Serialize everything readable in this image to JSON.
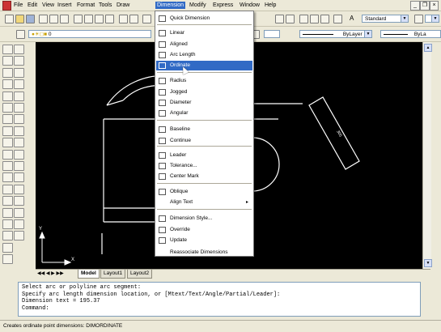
{
  "menubar": {
    "items": [
      "File",
      "Edit",
      "View",
      "Insert",
      "Format",
      "Tools",
      "Draw",
      "Dimension",
      "Modify",
      "Express",
      "Window",
      "Help"
    ],
    "active": "Dimension"
  },
  "toolbar": {
    "text_style": "Standard",
    "layer_value": "0",
    "linetype_value": "ByLayer",
    "lineweight_value": "ByLa"
  },
  "dimension_menu": {
    "items": [
      {
        "label": "Quick Dimension",
        "icon": "quick-dimension-icon"
      },
      {
        "label": "Linear",
        "icon": "linear-dim-icon"
      },
      {
        "label": "Aligned",
        "icon": "aligned-dim-icon"
      },
      {
        "label": "Arc Length",
        "icon": "arc-length-icon"
      },
      {
        "label": "Ordinate",
        "icon": "ordinate-icon",
        "highlighted": true
      },
      {
        "label": "Radius",
        "icon": "radius-icon"
      },
      {
        "label": "Jogged",
        "icon": "jogged-icon"
      },
      {
        "label": "Diameter",
        "icon": "diameter-icon"
      },
      {
        "label": "Angular",
        "icon": "angular-icon"
      },
      {
        "label": "Baseline",
        "icon": "baseline-icon"
      },
      {
        "label": "Continue",
        "icon": "continue-icon"
      },
      {
        "label": "Leader",
        "icon": "leader-icon"
      },
      {
        "label": "Tolerance...",
        "icon": "tolerance-icon"
      },
      {
        "label": "Center Mark",
        "icon": "center-mark-icon"
      },
      {
        "label": "Oblique",
        "icon": "oblique-icon"
      },
      {
        "label": "Align Text",
        "icon": "",
        "submenu": true
      },
      {
        "label": "Dimension Style...",
        "icon": "dimension-style-icon"
      },
      {
        "label": "Override",
        "icon": "override-icon"
      },
      {
        "label": "Update",
        "icon": "update-icon"
      },
      {
        "label": "Reassociate Dimensions",
        "icon": ""
      }
    ]
  },
  "drawing": {
    "dimension_text": "305"
  },
  "layout_tabs": [
    "Model",
    "Layout1",
    "Layout2"
  ],
  "active_tab": "Model",
  "command_window": {
    "lines": [
      "Select arc or polyline arc segment:",
      "Specify arc length dimension location, or [Mtext/Text/Angle/Partial/Leader]:",
      "Dimension text = 195.37"
    ],
    "prompt": "Command:"
  },
  "status_bar": {
    "text": "Creates ordinate point dimensions:  DIMORDINATE"
  },
  "colors": {
    "highlight": "#316ac5",
    "canvas": "#000000",
    "geometry": "#ffffff"
  }
}
